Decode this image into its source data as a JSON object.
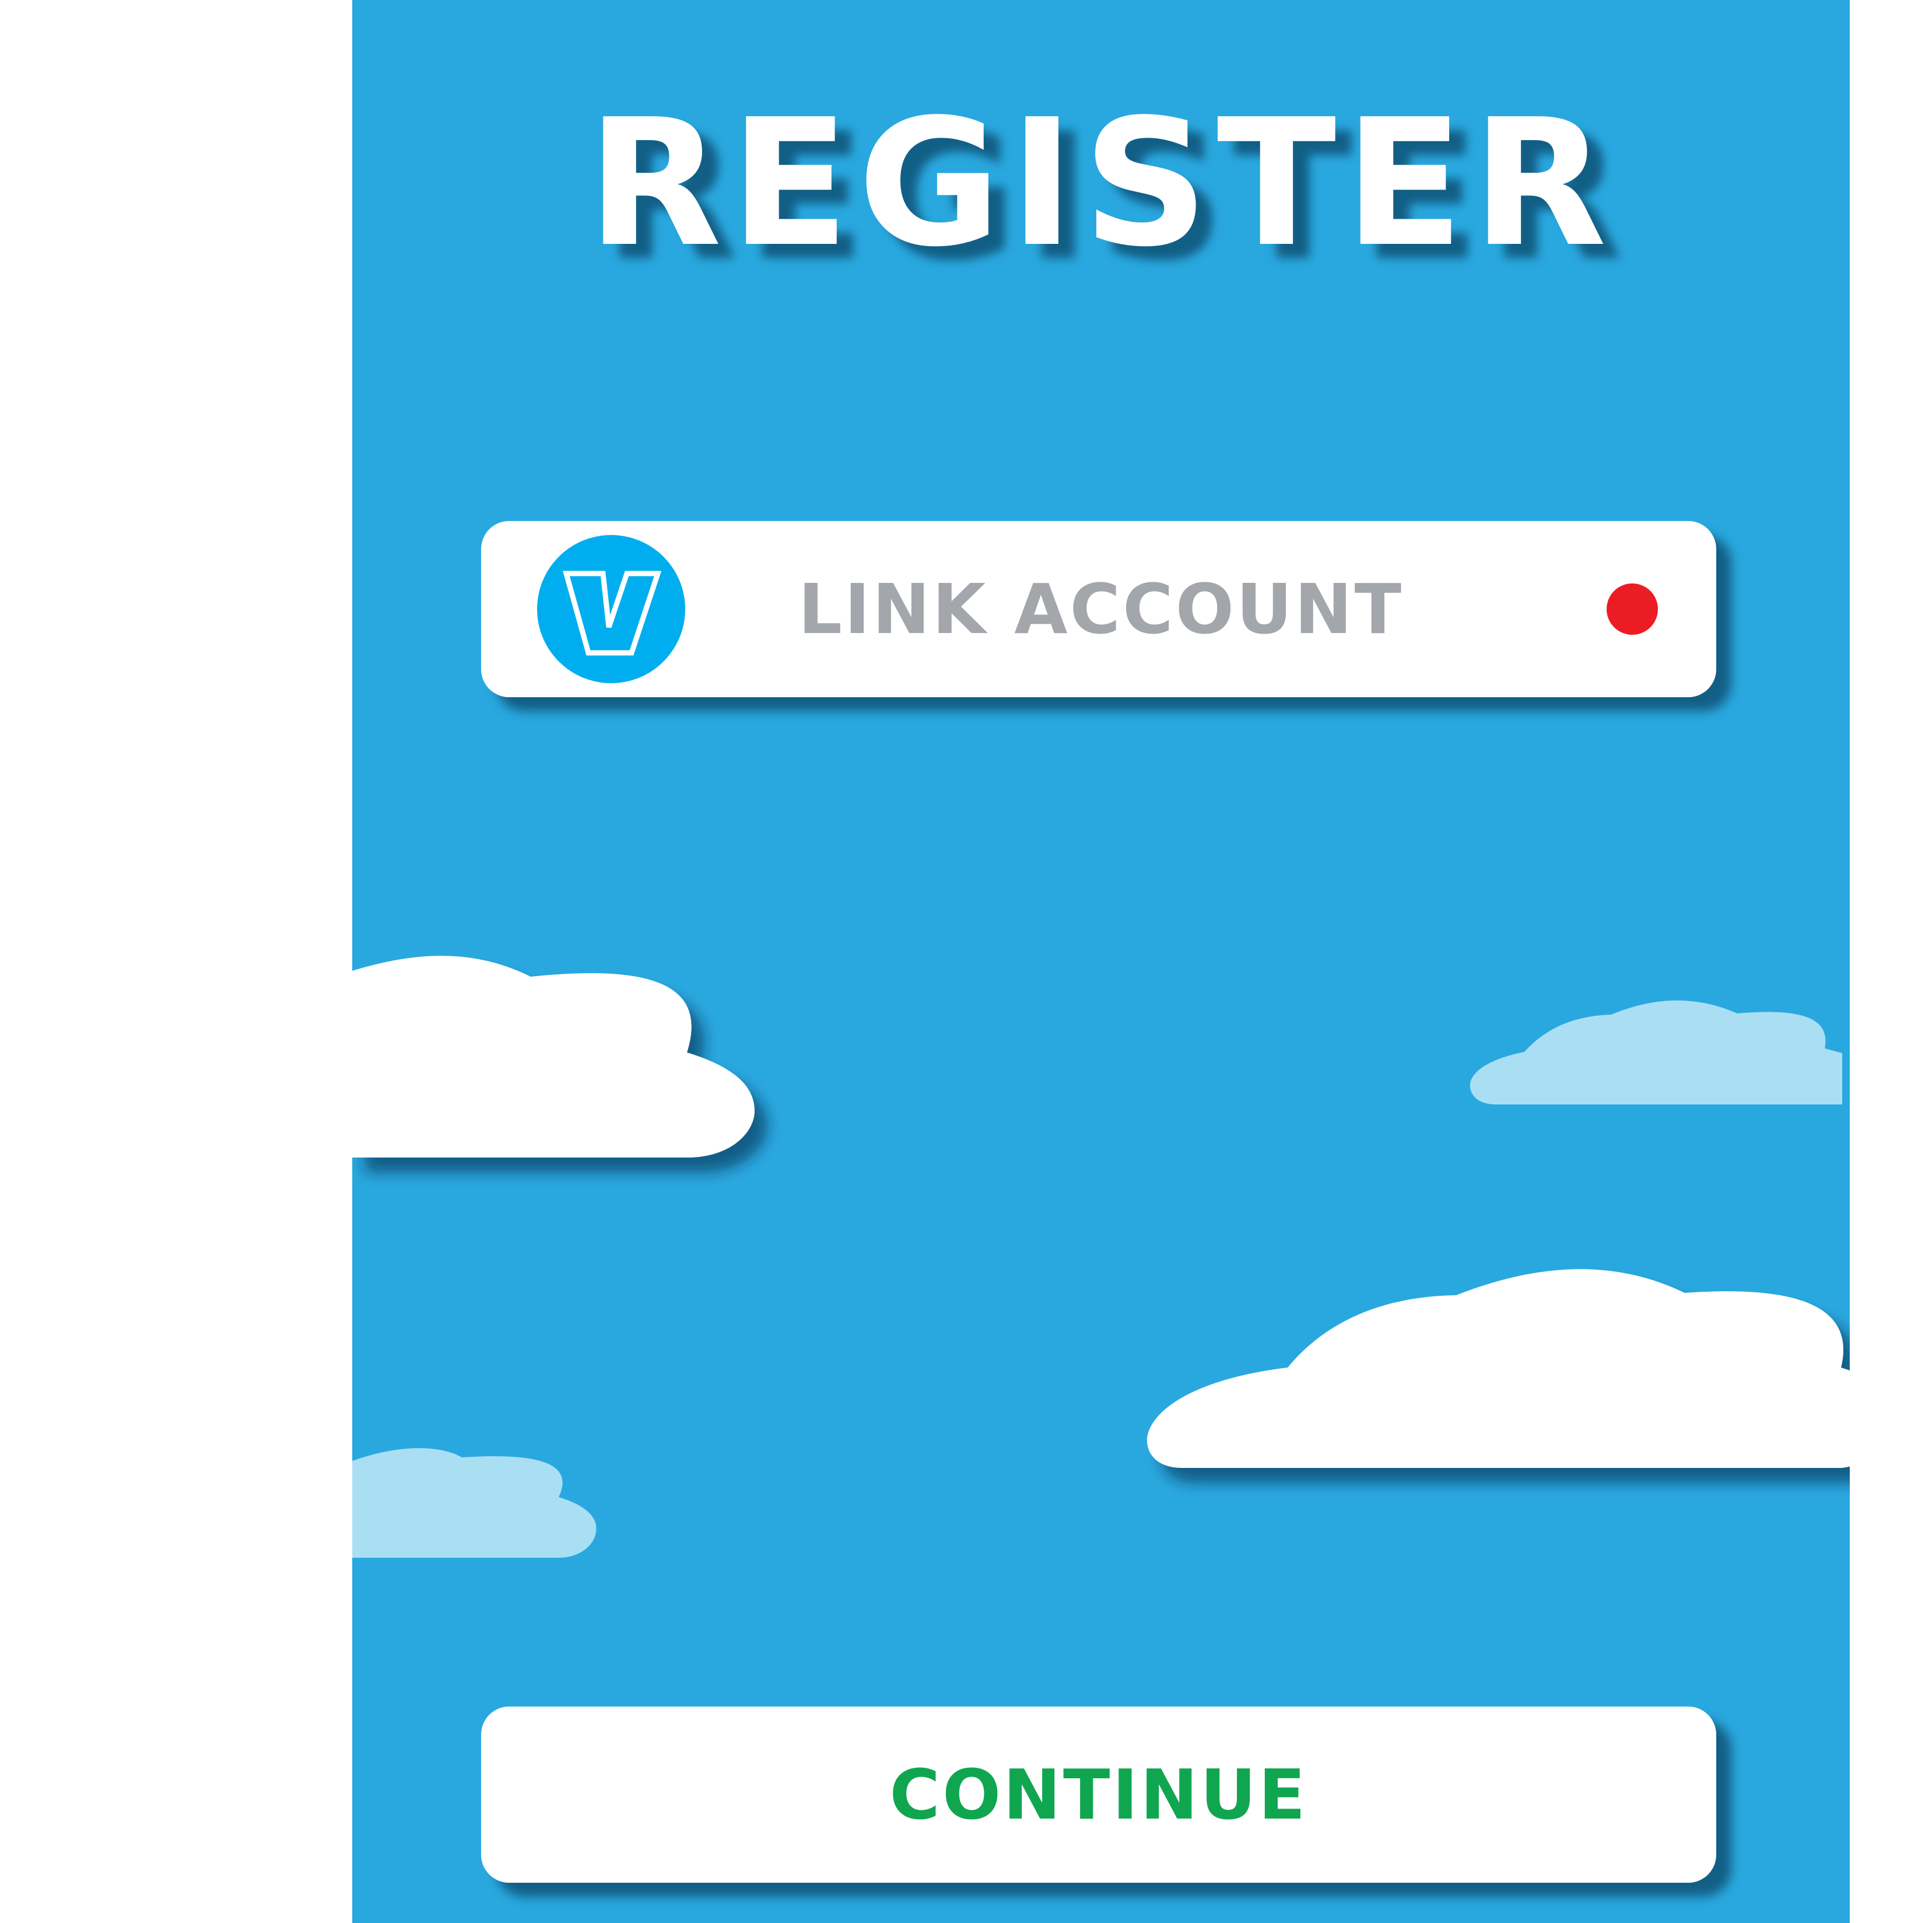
{
  "title": "REGISTER",
  "link_account": {
    "label": "LINK ACCOUNT",
    "logo_letter": "V",
    "logo_icon": "v-logo-icon",
    "status_icon": "status-dot-icon",
    "status_color": "#ec1c24"
  },
  "continue": {
    "label": "CONTINUE",
    "color": "#10a650"
  },
  "colors": {
    "background": "#29a8df",
    "panel": "#ffffff",
    "logo_circle": "#00aeef",
    "label_gray": "#a3a6ab",
    "cloud_white": "#ffffff",
    "cloud_light": "#aadff3"
  },
  "clouds": [
    "cloud-icon",
    "cloud-icon",
    "cloud-icon",
    "cloud-icon"
  ]
}
